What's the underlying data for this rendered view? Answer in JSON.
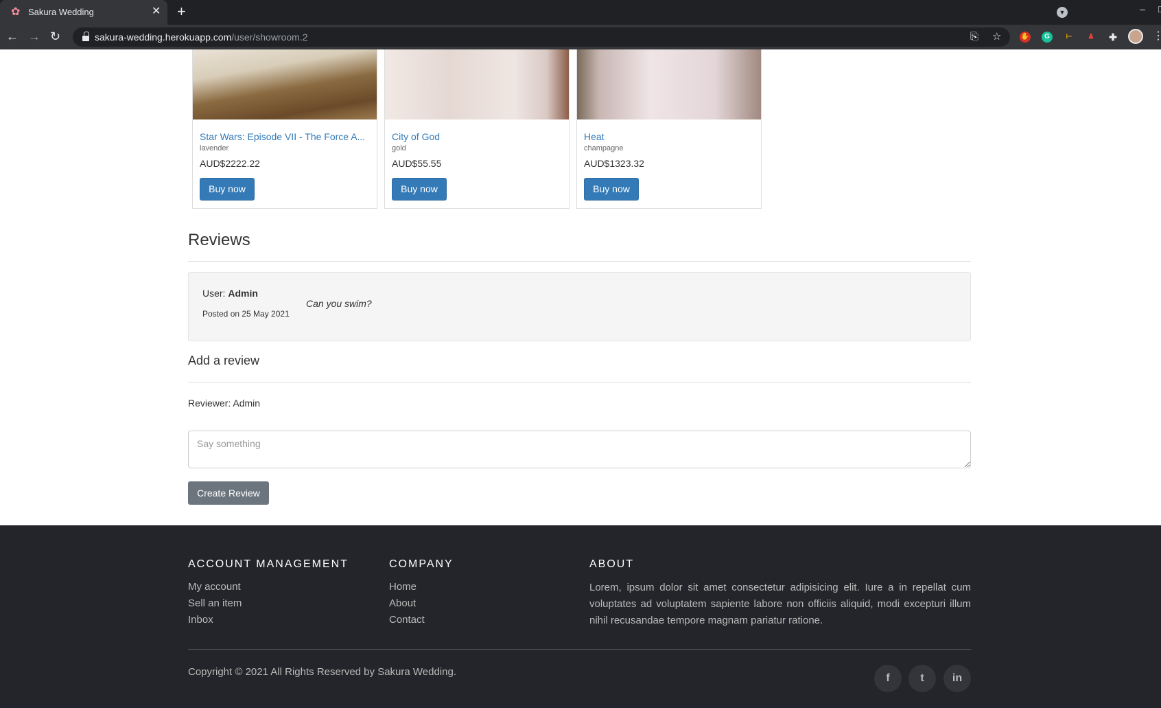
{
  "browser": {
    "tab_title": "Sakura Wedding",
    "url_host": "sakura-wedding.herokuapp.com",
    "url_path": "/user/showroom.2"
  },
  "products": [
    {
      "title": "Star Wars: Episode VII - The Force A...",
      "color": "lavender",
      "price": "AUD$2222.22",
      "buy_label": "Buy now",
      "image_colors": [
        "#6b4a2a",
        "#9c7a4e",
        "#e9e2d6"
      ]
    },
    {
      "title": "City of God",
      "color": "gold",
      "price": "AUD$55.55",
      "buy_label": "Buy now",
      "image_colors": [
        "#efe6e2",
        "#d9c9c4",
        "#8c5e4a"
      ]
    },
    {
      "title": "Heat",
      "color": "champagne",
      "price": "AUD$1323.32",
      "buy_label": "Buy now",
      "image_colors": [
        "#7a6a5a",
        "#e4d6d8",
        "#f2eaea"
      ]
    }
  ],
  "reviews": {
    "heading": "Reviews",
    "items": [
      {
        "user_prefix": "User:",
        "user_name": "Admin",
        "posted": "Posted on 25 May 2021",
        "text": "Can you swim?"
      }
    ]
  },
  "add_review": {
    "heading": "Add a review",
    "reviewer": "Reviewer: Admin",
    "placeholder": "Say something",
    "value": "",
    "submit_label": "Create Review"
  },
  "footer": {
    "account": {
      "heading": "ACCOUNT MANAGEMENT",
      "links": [
        "My account",
        "Sell an item",
        "Inbox"
      ]
    },
    "company": {
      "heading": "COMPANY",
      "links": [
        "Home",
        "About",
        "Contact"
      ]
    },
    "about": {
      "heading": "ABOUT",
      "text": "Lorem, ipsum dolor sit amet consectetur adipisicing elit. Iure a in repellat cum voluptates ad voluptatem sapiente labore non officiis aliquid, modi excepturi illum nihil recusandae tempore magnam pariatur ratione."
    },
    "copyright": "Copyright © 2021 All Rights Reserved by Sakura Wedding.",
    "social": [
      {
        "icon": "facebook-icon",
        "glyph": "f"
      },
      {
        "icon": "twitter-icon",
        "glyph": "t"
      },
      {
        "icon": "linkedin-icon",
        "glyph": "in"
      }
    ]
  },
  "colors": {
    "link": "#337ab7",
    "primary_button": "#337ab7",
    "secondary_button": "#6c757d",
    "footer_bg": "#24252a"
  }
}
